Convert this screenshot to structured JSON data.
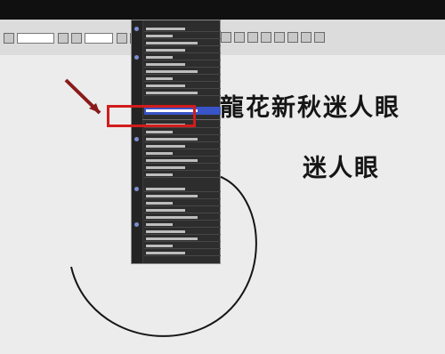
{
  "canvas": {
    "headline": "龍花新秋迷人眼",
    "subline": "迷人眼"
  },
  "colors": {
    "menu_bg": "#2d2d2d",
    "menu_highlight": "#3954c7",
    "callout": "#d21c1c"
  },
  "icons": [
    "font-list-icon",
    "arrow-pointer-icon",
    "circle-stroke-icon"
  ]
}
